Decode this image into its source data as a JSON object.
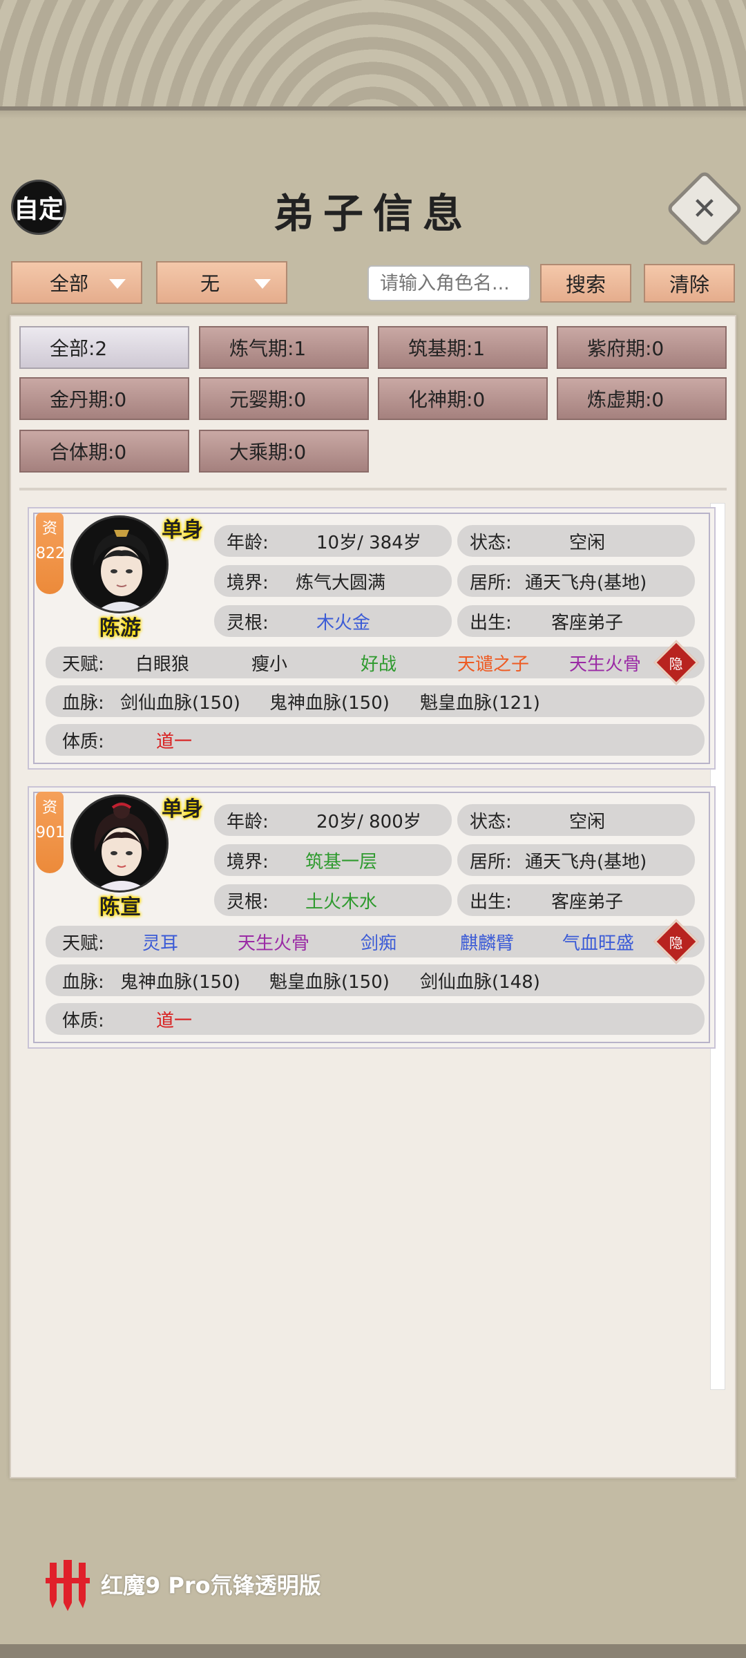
{
  "header": {
    "custom_label": "自定",
    "title": "弟子信息",
    "close_glyph": "✕"
  },
  "filters": {
    "dropdown1": "全部",
    "dropdown2": "无",
    "search_placeholder": "请输入角色名...",
    "search_label": "搜索",
    "clear_label": "清除"
  },
  "tabs": [
    "全部:2",
    "炼气期:1",
    "筑基期:1",
    "紫府期:0",
    "金丹期:0",
    "元婴期:0",
    "化神期:0",
    "炼虚期:0",
    "合体期:0",
    "大乘期:0"
  ],
  "disciples": [
    {
      "zi_label": "资",
      "zi_value": "822",
      "single": "单身",
      "name": "陈游",
      "age_label": "年龄:",
      "age": "10岁/ 384岁",
      "status_label": "状态:",
      "status": "空闲",
      "realm_label": "境界:",
      "realm": "炼气大圆满",
      "realm_color": "#222222",
      "home_label": "居所:",
      "home": "通天飞舟(基地)",
      "root_label": "灵根:",
      "root": "木火金",
      "root_color": "#3b5bd6",
      "birth_label": "出生:",
      "birth": "客座弟子",
      "talent_label": "天赋:",
      "talents": [
        {
          "text": "白眼狼",
          "color": "#222222"
        },
        {
          "text": "瘦小",
          "color": "#222222"
        },
        {
          "text": "好战",
          "color": "#2e9a2e"
        },
        {
          "text": "天谴之子",
          "color": "#ee5a22"
        },
        {
          "text": "天生火骨",
          "color": "#9a2aa5"
        }
      ],
      "hide_label": "隐",
      "blood_label": "血脉:",
      "bloodlines": [
        "剑仙血脉(150)",
        "鬼神血脉(150)",
        "魁皇血脉(121)"
      ],
      "body_label": "体质:",
      "body": "道一",
      "body_color": "#d82020"
    },
    {
      "zi_label": "资",
      "zi_value": "901",
      "single": "单身",
      "name": "陈宣",
      "age_label": "年龄:",
      "age": "20岁/ 800岁",
      "status_label": "状态:",
      "status": "空闲",
      "realm_label": "境界:",
      "realm": "筑基一层",
      "realm_color": "#2e9a2e",
      "home_label": "居所:",
      "home": "通天飞舟(基地)",
      "root_label": "灵根:",
      "root": "土火木水",
      "root_color": "#2e9a2e",
      "birth_label": "出生:",
      "birth": "客座弟子",
      "talent_label": "天赋:",
      "talents": [
        {
          "text": "灵耳",
          "color": "#3b5bd6"
        },
        {
          "text": "天生火骨",
          "color": "#9a2aa5"
        },
        {
          "text": "剑痴",
          "color": "#3b5bd6"
        },
        {
          "text": "麒麟臂",
          "color": "#3b5bd6"
        },
        {
          "text": "气血旺盛",
          "color": "#3b5bd6"
        }
      ],
      "hide_label": "隐",
      "blood_label": "血脉:",
      "bloodlines": [
        "鬼神血脉(150)",
        "魁皇血脉(150)",
        "剑仙血脉(148)"
      ],
      "body_label": "体质:",
      "body": "道一",
      "body_color": "#d82020"
    }
  ],
  "brand_text": "红魔9 Pro氘锋透明版"
}
